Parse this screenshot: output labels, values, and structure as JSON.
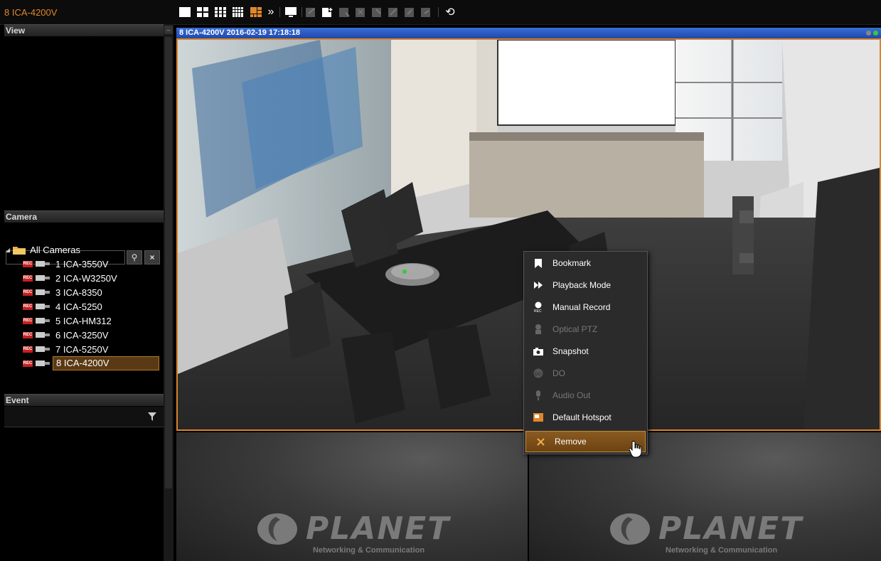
{
  "app": {
    "title": "8 ICA-4200V"
  },
  "toolbar": {
    "icons": [
      "layout-1x1-icon",
      "layout-2x2-icon",
      "layout-3x3-icon",
      "layout-4x4-icon",
      "layout-custom-icon",
      "more-layouts-icon",
      "fullscreen-icon",
      "add-view-icon",
      "new-view-icon",
      "edit-view-icon",
      "delete-view-icon",
      "save-view-icon",
      "rename-view-icon",
      "refresh-icon"
    ],
    "more_glyph": "»",
    "refresh_glyph": "⟲"
  },
  "sidebar": {
    "view_header": "View",
    "camera_header": "Camera",
    "event_header": "Event",
    "search": {
      "value": "",
      "placeholder": ""
    },
    "search_glyph": "⚲",
    "clear_glyph": "×",
    "tree_root": "All Cameras",
    "rec_badge": "REC",
    "cameras": [
      {
        "label": "1 ICA-3550V"
      },
      {
        "label": "2 ICA-W3250V"
      },
      {
        "label": "3 ICA-8350"
      },
      {
        "label": "4 ICA-5250"
      },
      {
        "label": "5 ICA-HM312"
      },
      {
        "label": "6 ICA-3250V"
      },
      {
        "label": "7 ICA-5250V"
      },
      {
        "label": "8 ICA-4200V"
      }
    ],
    "selected_camera": "8 ICA-4200V"
  },
  "viewer": {
    "title": "8 ICA-4200V  2016-02-19 17:18:18",
    "empty_tile_logo": "PLANET",
    "empty_tile_sub": "Networking & Communication"
  },
  "context_menu": {
    "items": [
      {
        "label": "Bookmark",
        "icon": "bookmark-icon",
        "enabled": true
      },
      {
        "label": "Playback Mode",
        "icon": "fast-forward-icon",
        "enabled": true
      },
      {
        "label": "Manual Record",
        "icon": "record-icon",
        "enabled": true
      },
      {
        "label": "Optical PTZ",
        "icon": "ptz-icon",
        "enabled": false
      },
      {
        "label": "Snapshot",
        "icon": "camera-icon",
        "enabled": true
      },
      {
        "label": "DO",
        "icon": "digital-output-icon",
        "enabled": false
      },
      {
        "label": "Audio Out",
        "icon": "microphone-icon",
        "enabled": false
      },
      {
        "label": "Default Hotspot",
        "icon": "hotspot-icon",
        "enabled": true
      },
      {
        "label": "Remove",
        "icon": "close-icon",
        "enabled": true,
        "hovered": true
      }
    ]
  },
  "colors": {
    "accent": "#e0872b",
    "titlebar": "#2a5cc8",
    "rec": "#c62020"
  }
}
